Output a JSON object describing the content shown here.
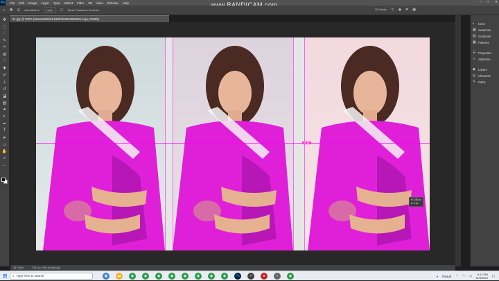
{
  "watermark": "www.BANDICAM.com",
  "menu": [
    "File",
    "Edit",
    "Image",
    "Layer",
    "Type",
    "Select",
    "Filter",
    "3D",
    "View",
    "Window",
    "Help"
  ],
  "options": {
    "auto_select": "Auto-Select:",
    "layer": "Layer",
    "transform": "Show Transform Controls",
    "mode": "3D Mode:"
  },
  "doc_tab": "01.jpg @ 200% (561a0495631b1f94b7fa30260d0256-copy, RGB/8)",
  "guide_label": "23 px",
  "tooltip": {
    "line1": "H: 240 px",
    "line2": "Δ: 0 px"
  },
  "right_panel": {
    "groups": [
      [
        {
          "icon": "color-icon",
          "label": "Color"
        },
        {
          "icon": "swatches-icon",
          "label": "Swatches"
        },
        {
          "icon": "gradients-icon",
          "label": "Gradients"
        },
        {
          "icon": "patterns-icon",
          "label": "Patterns"
        }
      ],
      [
        {
          "icon": "properties-icon",
          "label": "Properties"
        },
        {
          "icon": "adjustments-icon",
          "label": "Adjustme..."
        }
      ],
      [
        {
          "icon": "layers-icon",
          "label": "Layers"
        },
        {
          "icon": "channels-icon",
          "label": "Channels"
        },
        {
          "icon": "paths-icon",
          "label": "Paths"
        }
      ]
    ]
  },
  "status": {
    "zoom": "267.84%",
    "size": "724 px x 396 px (96 ppi)"
  },
  "taskbar": {
    "search_placeholder": "Type here to search",
    "tray_result": "Result",
    "time": "6:12 PM",
    "date": "11/3/2023"
  },
  "colors": {
    "accent": "#ff00ff",
    "saree": "#e020d8"
  }
}
